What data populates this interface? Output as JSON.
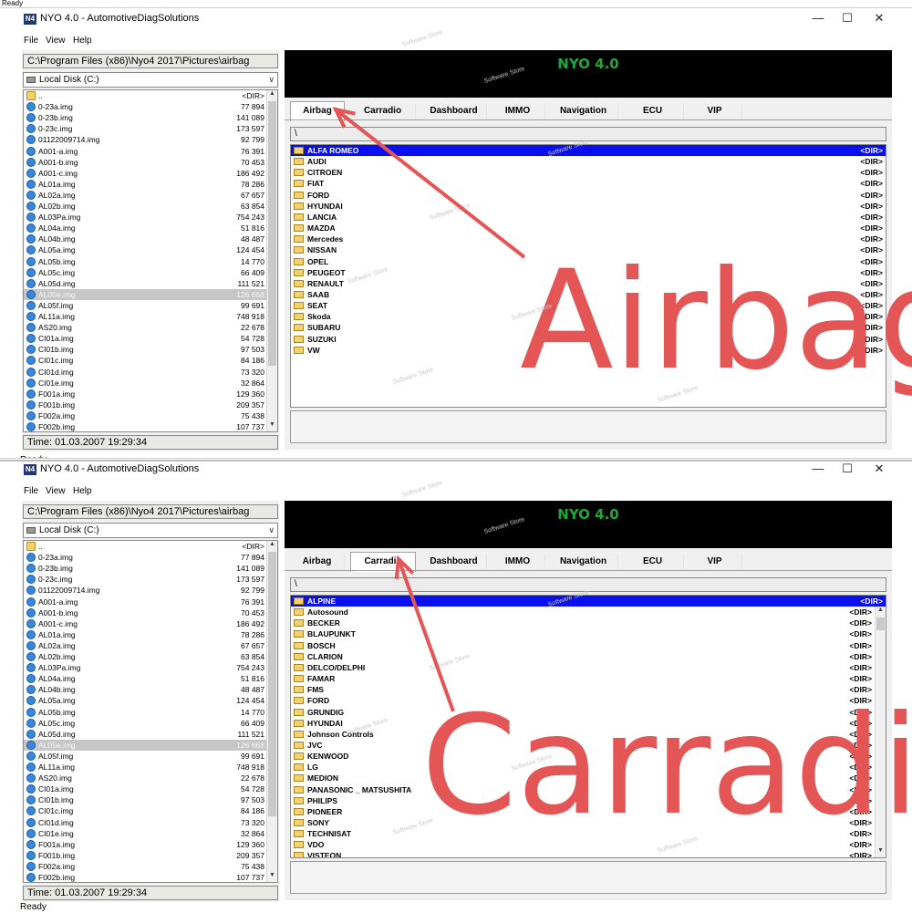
{
  "top_strip": "Ready",
  "windows": [
    {
      "title": "NYO 4.0 - AutomotiveDiagSolutions",
      "app_icon_text": "N4",
      "menu": [
        "File",
        "View",
        "Help"
      ],
      "path": "C:\\Program Files (x86)\\Nyo4 2017\\Pictures\\airbag",
      "drive": "Local Disk (C:)",
      "time": "Time: 01.03.2007 19:29:34",
      "status": "Ready",
      "banner": "NYO 4.0",
      "active_tab": "Airbag",
      "right_path": "\\",
      "dirs": [
        "ALFA ROMEO",
        "AUDI",
        "CITROEN",
        "FIAT",
        "FORD",
        "HYUNDAI",
        "LANCIA",
        "MAZDA",
        "Mercedes",
        "NISSAN",
        "OPEL",
        "PEUGEOT",
        "RENAULT",
        "SAAB",
        "SEAT",
        "Skoda",
        "SUBARU",
        "SUZUKI",
        "VW"
      ],
      "annotation": "Airbag"
    },
    {
      "title": "NYO 4.0 - AutomotiveDiagSolutions",
      "app_icon_text": "N4",
      "menu": [
        "File",
        "View",
        "Help"
      ],
      "path": "C:\\Program Files (x86)\\Nyo4 2017\\Pictures\\airbag",
      "drive": "Local Disk (C:)",
      "time": "Time: 01.03.2007 19:29:34",
      "status": "Ready",
      "banner": "NYO 4.0",
      "active_tab": "Carradio",
      "right_path": "\\",
      "dirs": [
        "ALPINE",
        "Autosound",
        "BECKER",
        "BLAUPUNKT",
        "BOSCH",
        "CLARION",
        "DELCO/DELPHI",
        "FAMAR",
        "FMS",
        "FORD",
        "GRUNDIG",
        "HYUNDAI",
        "Johnson Controls",
        "JVC",
        "KENWOOD",
        "LG",
        "MEDION",
        "PANASONIC _ MATSUSHITA",
        "PHILIPS",
        "PIONEER",
        "SONY",
        "TECHNISAT",
        "VDO",
        "VISTEON"
      ],
      "annotation": "Carradio"
    }
  ],
  "tabs": [
    "Airbag",
    "Carradio",
    "Dashboard",
    "IMMO",
    "Navigation",
    "ECU",
    "VIP"
  ],
  "dir_tag": "<DIR>",
  "files": [
    {
      "name": "..",
      "size": "<DIR>",
      "folder": true
    },
    {
      "name": "0-23a.img",
      "size": "77 894"
    },
    {
      "name": "0-23b.img",
      "size": "141 089"
    },
    {
      "name": "0-23c.img",
      "size": "173 597"
    },
    {
      "name": "01122009714.img",
      "size": "92 799"
    },
    {
      "name": "A001-a.img",
      "size": "76 391"
    },
    {
      "name": "A001-b.img",
      "size": "70 453"
    },
    {
      "name": "A001-c.img",
      "size": "186 492"
    },
    {
      "name": "AL01a.img",
      "size": "78 286"
    },
    {
      "name": "AL02a.img",
      "size": "67 657"
    },
    {
      "name": "AL02b.img",
      "size": "63 854"
    },
    {
      "name": "AL03Pa.img",
      "size": "754 243"
    },
    {
      "name": "AL04a.img",
      "size": "51 816"
    },
    {
      "name": "AL04b.img",
      "size": "48 487"
    },
    {
      "name": "AL05a.img",
      "size": "124 454"
    },
    {
      "name": "AL05b.img",
      "size": "14 770"
    },
    {
      "name": "AL05c.img",
      "size": "66 409"
    },
    {
      "name": "AL05d.img",
      "size": "111 521"
    },
    {
      "name": "AL05e.img",
      "size": "126 668",
      "selected": true
    },
    {
      "name": "AL05f.img",
      "size": "99 691"
    },
    {
      "name": "AL11a.img",
      "size": "748 918"
    },
    {
      "name": "AS20.img",
      "size": "22 678"
    },
    {
      "name": "CI01a.img",
      "size": "54 728"
    },
    {
      "name": "CI01b.img",
      "size": "97 503"
    },
    {
      "name": "CI01c.img",
      "size": "84 186"
    },
    {
      "name": "CI01d.img",
      "size": "73 320"
    },
    {
      "name": "CI01e.img",
      "size": "32 864"
    },
    {
      "name": "F001a.img",
      "size": "129 360"
    },
    {
      "name": "F001b.img",
      "size": "209 357"
    },
    {
      "name": "F002a.img",
      "size": "75 438"
    },
    {
      "name": "F002b.img",
      "size": "107 737"
    }
  ],
  "watermark": "Software Store",
  "colors": {
    "banner_text": "#1fa83a",
    "selection": "#0a0ff0",
    "annotation": "#e45656"
  },
  "window_controls": [
    "minimize-icon",
    "maximize-icon",
    "close-icon"
  ]
}
